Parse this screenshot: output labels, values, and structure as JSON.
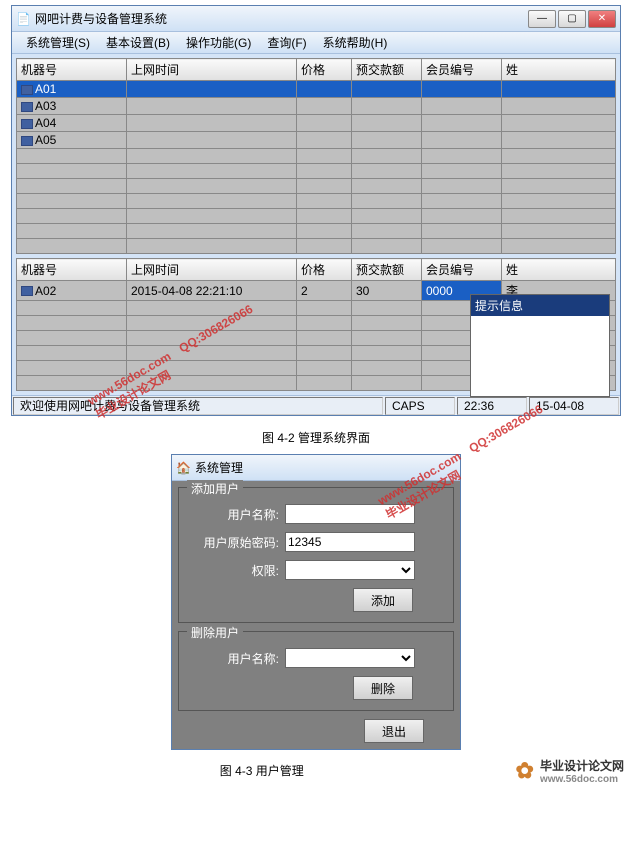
{
  "mainWindow": {
    "title": "网吧计费与设备管理系统",
    "menus": [
      "系统管理(S)",
      "基本设置(B)",
      "操作功能(G)",
      "查询(F)",
      "系统帮助(H)"
    ],
    "columns": [
      "机器号",
      "上网时间",
      "价格",
      "预交款额",
      "会员编号",
      "姓"
    ],
    "rows": [
      {
        "machine": "A01",
        "sel": true
      },
      {
        "machine": "A03"
      },
      {
        "machine": "A04"
      },
      {
        "machine": "A05"
      }
    ],
    "columns2": [
      "机器号",
      "上网时间",
      "价格",
      "预交款额",
      "会员编号",
      "姓"
    ],
    "rows2": [
      {
        "machine": "A02",
        "time": "2015-04-08 22:21:10",
        "price": "2",
        "prepay": "30",
        "member": "0000",
        "name": "李"
      }
    ],
    "tooltipTitle": "提示信息",
    "status": {
      "welcome": "欢迎使用网吧计费与设备管理系统",
      "caps": "CAPS",
      "time": "22:36",
      "date": "15-04-08"
    }
  },
  "caption1": "图 4-2 管理系统界面",
  "dialog": {
    "title": "系统管理",
    "addGroup": "添加用户",
    "userNameLabel": "用户名称:",
    "userPassLabel": "用户原始密码:",
    "userPassValue": "12345",
    "permLabel": "权限:",
    "addBtn": "添加",
    "delGroup": "删除用户",
    "delUserLabel": "用户名称:",
    "delBtn": "删除",
    "exitBtn": "退出"
  },
  "caption2": "图 4-3   用户管理",
  "watermarks": {
    "url": "www.56doc.com",
    "site": "毕业设计论文网",
    "qq": "QQ:306826066"
  },
  "footer": {
    "site": "毕业设计论文网",
    "url": "www.56doc.com"
  }
}
